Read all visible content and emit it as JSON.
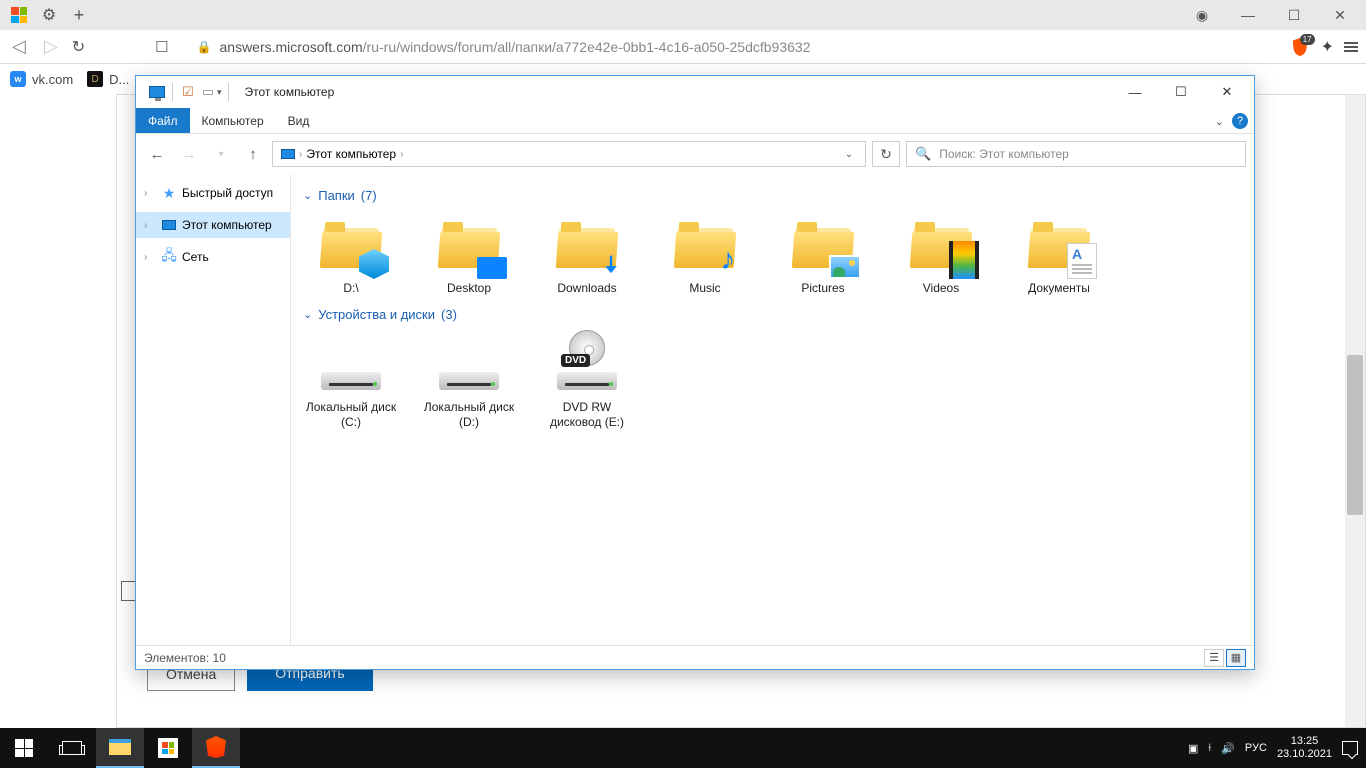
{
  "browser": {
    "url_host": "answers.microsoft.com",
    "url_path": "/ru-ru/windows/forum/all/папки/a772e42e-0bb1-4c16-a050-25dcfb93632",
    "shield_count": "17",
    "bookmarks": [
      {
        "label": "vk.com"
      },
      {
        "label": "D..."
      }
    ],
    "page_buttons": {
      "cancel": "Отмена",
      "send": "Отправить"
    }
  },
  "explorer": {
    "title": "Этот компьютер",
    "ribbon": {
      "file": "Файл",
      "computer": "Компьютер",
      "view": "Вид"
    },
    "breadcrumb": "Этот компьютер",
    "search_placeholder": "Поиск: Этот компьютер",
    "tree": {
      "quick": "Быстрый доступ",
      "thispc": "Этот компьютер",
      "network": "Сеть"
    },
    "groups": {
      "folders": {
        "label": "Папки",
        "count": "(7)"
      },
      "devices": {
        "label": "Устройства и диски",
        "count": "(3)"
      }
    },
    "folders": [
      {
        "label": "D:\\"
      },
      {
        "label": "Desktop"
      },
      {
        "label": "Downloads"
      },
      {
        "label": "Music"
      },
      {
        "label": "Pictures"
      },
      {
        "label": "Videos"
      },
      {
        "label": "Документы"
      }
    ],
    "drives": [
      {
        "label": "Локальный диск (C:)"
      },
      {
        "label": "Локальный диск (D:)"
      },
      {
        "label": "DVD RW дисковод (E:)"
      }
    ],
    "status": "Элементов: 10"
  },
  "taskbar": {
    "lang": "РУС",
    "time": "13:25",
    "date": "23.10.2021"
  }
}
